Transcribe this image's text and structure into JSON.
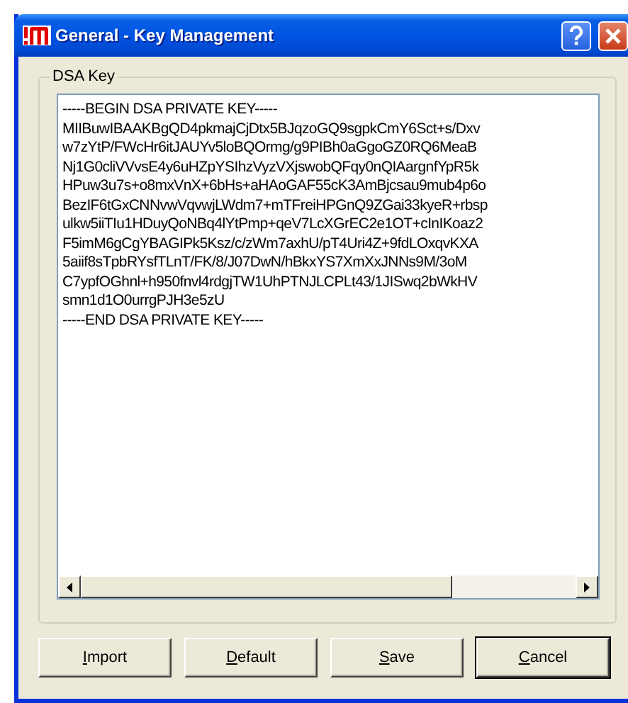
{
  "window": {
    "title": "General - Key Management"
  },
  "group": {
    "label": "DSA Key"
  },
  "key_text": [
    "-----BEGIN DSA PRIVATE KEY-----",
    "MIIBuwIBAAKBgQD4pkmajCjDtx5BJqzoGQ9sgpkCmY6Sct+s/Dxv",
    "w7zYtP/FWcHr6itJAUYv5loBQOrmg/g9PIBh0aGgoGZ0RQ6MeaB",
    "Nj1G0cliVVvsE4y6uHZpYSIhzVyzVXjswobQFqy0nQIAargnfYpR5k",
    "HPuw3u7s+o8mxVnX+6bHs+aHAoGAF55cK3AmBjcsau9mub4p6o",
    "BezIF6tGxCNNvwVqvwjLWdm7+mTFreiHPGnQ9ZGai33kyeR+rbsp",
    "ulkw5iiTIu1HDuyQoNBq4lYtPmp+qeV7LcXGrEC2e1OT+cInIKoaz2",
    "F5imM6gCgYBAGIPk5Ksz/c/zWm7axhU/pT4Uri4Z+9fdLOxqvKXA",
    "5aiif8sTpbRYsfTLnT/FK/8/J07DwN/hBkxYS7XmXxJNNs9M/3oM",
    "C7ypfOGhnl+h950fnvl4rdgjTW1UhPTNJLCPLt43/1JISwq2bWkHV",
    "smn1d1O0urrgPJH3e5zU",
    "-----END DSA PRIVATE KEY-----"
  ],
  "buttons": [
    {
      "label": "Import",
      "default": false
    },
    {
      "label": "Default",
      "default": false
    },
    {
      "label": "Save",
      "default": false
    },
    {
      "label": "Cancel",
      "default": true
    }
  ]
}
